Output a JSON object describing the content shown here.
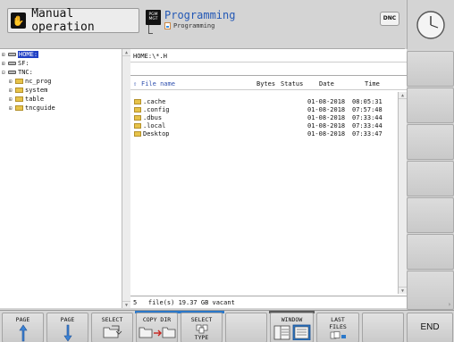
{
  "header": {
    "left_mode": "Manual operation",
    "right_mode": "Programming",
    "right_sub": "Programming",
    "pgm_icon": "PGM MGT",
    "dnc_label": "DNC"
  },
  "tree": {
    "items": [
      {
        "label": "HOME:",
        "level": 0,
        "kind": "drive",
        "selected": true
      },
      {
        "label": "SF:",
        "level": 0,
        "kind": "drive"
      },
      {
        "label": "TNC:",
        "level": 0,
        "kind": "drive"
      },
      {
        "label": "nc_prog",
        "level": 1,
        "kind": "folder"
      },
      {
        "label": "system",
        "level": 1,
        "kind": "folder"
      },
      {
        "label": "table",
        "level": 1,
        "kind": "folder"
      },
      {
        "label": "tncguide",
        "level": 1,
        "kind": "folder"
      }
    ]
  },
  "files": {
    "path": "HOME:\\*.H",
    "columns": {
      "name": "File name",
      "bytes": "Bytes",
      "status": "Status",
      "date": "Date",
      "time": "Time"
    },
    "rows": [
      {
        "name": ".cache",
        "date": "01-08-2018",
        "time": "08:05:31"
      },
      {
        "name": ".config",
        "date": "01-08-2018",
        "time": "07:57:48"
      },
      {
        "name": ".dbus",
        "date": "01-08-2018",
        "time": "07:33:44"
      },
      {
        "name": ".local",
        "date": "01-08-2018",
        "time": "07:33:44"
      },
      {
        "name": "Desktop",
        "date": "01-08-2018",
        "time": "07:33:47"
      }
    ],
    "status": "5   file(s) 19.37 GB vacant"
  },
  "softkeys": {
    "page_up": "PAGE",
    "page_down": "PAGE",
    "select": "SELECT",
    "copy_dir": "COPY DIR",
    "select_type_1": "SELECT",
    "select_type_2": "TYPE",
    "window": "WINDOW",
    "last_files_1": "LAST",
    "last_files_2": "FILES",
    "end": "END"
  },
  "icons": {
    "left_mode": "hand-icon",
    "right_mode": "pgm-mgt-icon",
    "clock": "clock-icon"
  },
  "colors": {
    "accent_blue": "#2358b5",
    "selection": "#1f3fc4",
    "folder": "#e7c34a"
  }
}
